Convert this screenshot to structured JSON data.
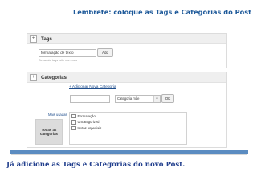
{
  "reminder": "Lembrete: coloque as Tags e Categorias do Post",
  "tags_box": {
    "title": "Tags",
    "toggle": "+",
    "input_value": "formatação de texto",
    "add_label": "Add",
    "hint": "Separate tags with commas"
  },
  "categories_box": {
    "title": "Categorias",
    "toggle": "+",
    "add_link": "+ Adicionar Nova Categoria",
    "parent_select": "Categoria mãe",
    "ok_label": "OK",
    "most_used": "Mais usadas",
    "all_label": "Todas as categorias",
    "items": [
      "Formatação",
      "Uncategorized",
      "textos especiais"
    ]
  },
  "caption": "Já adicione as Tags e Categorias do novo Post.",
  "colors": {
    "reminder": "#1f5a9a",
    "caption": "#23408e",
    "accent_bar": "#5b8cc1"
  }
}
